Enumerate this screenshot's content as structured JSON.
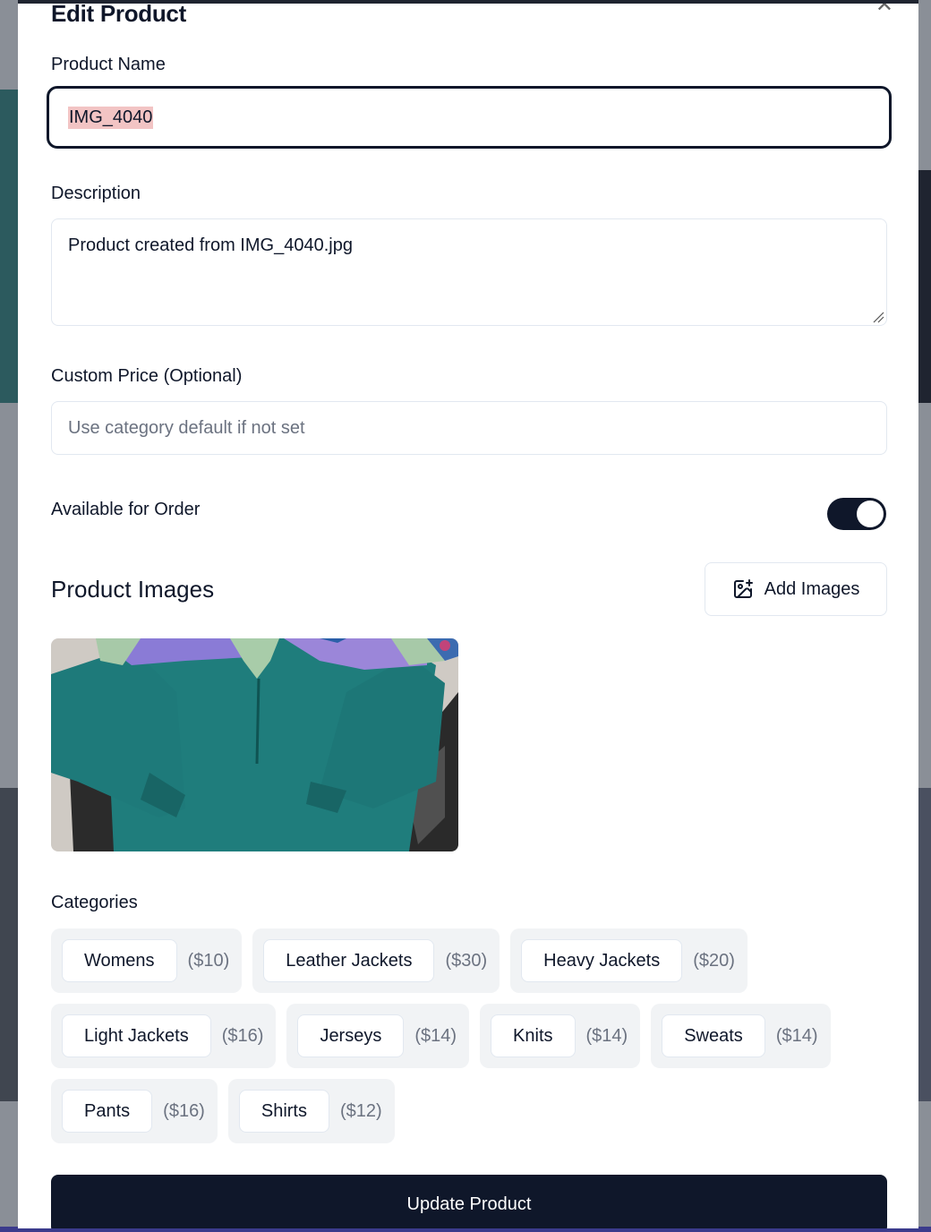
{
  "modal": {
    "title": "Edit Product",
    "close_icon": "close-icon"
  },
  "product_name": {
    "label": "Product Name",
    "value": "IMG_4040"
  },
  "description": {
    "label": "Description",
    "value": "Product created from IMG_4040.jpg"
  },
  "custom_price": {
    "label": "Custom Price (Optional)",
    "placeholder": "Use category default if not set",
    "value": ""
  },
  "available": {
    "label": "Available for Order",
    "enabled": true
  },
  "images": {
    "section_title": "Product Images",
    "add_label": "Add Images",
    "add_icon": "image-plus-icon"
  },
  "categories": {
    "label": "Categories",
    "rows": [
      [
        {
          "name": "Womens",
          "price": "($10)"
        },
        {
          "name": "Leather Jackets",
          "price": "($30)"
        },
        {
          "name": "Heavy Jackets",
          "price": "($20)"
        }
      ],
      [
        {
          "name": "Light Jackets",
          "price": "($16)"
        },
        {
          "name": "Jerseys",
          "price": "($14)"
        },
        {
          "name": "Knits",
          "price": "($14)"
        },
        {
          "name": "Sweats",
          "price": "($14)"
        }
      ],
      [
        {
          "name": "Pants",
          "price": "($16)"
        },
        {
          "name": "Shirts",
          "price": "($12)"
        }
      ]
    ]
  },
  "submit_label": "Update Product",
  "colors": {
    "primary": "#0f172a",
    "muted_text": "#6b7280",
    "chip_bg": "#f1f3f5",
    "selection": "#f2c4c4"
  }
}
